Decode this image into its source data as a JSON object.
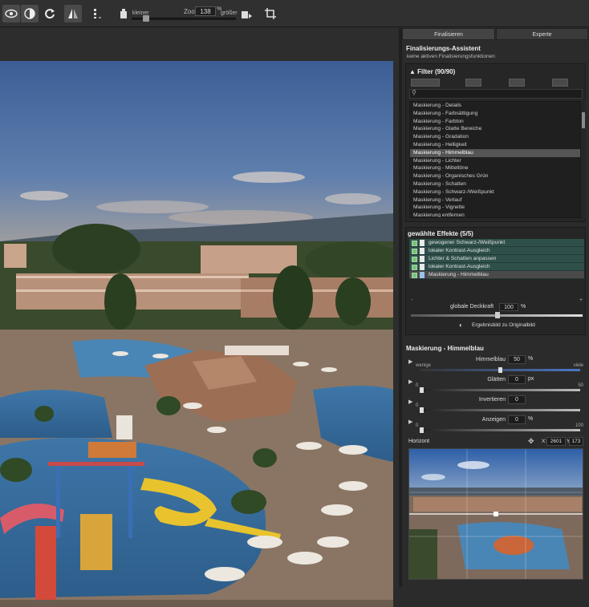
{
  "toolbar": {
    "zoom_small": "kleiner",
    "zoom_label": "Zoo",
    "zoom_value": "138",
    "zoom_unit": "%",
    "zoom_large": "größer"
  },
  "tabs": [
    {
      "label": "Finalisieren",
      "active": true
    },
    {
      "label": "Experte",
      "active": false
    }
  ],
  "assistant": {
    "title": "Finalisierungs-Assistent",
    "subtitle": "keine aktiven Finalisierungsfunktionen"
  },
  "filter": {
    "header": "Filter (90/90)",
    "items": [
      "Maskierung - Details",
      "Maskierung - Farbsättigung",
      "Maskierung - Farbton",
      "Maskierung - Glatte Bereiche",
      "Maskierung - Gradation",
      "Maskierung - Helligkeit",
      "Maskierung - Himmelblau",
      "Maskierung - Lichter",
      "Maskierung - Mitteltöne",
      "Maskierung - Organisches Grün",
      "Maskierung - Schatten",
      "Maskierung - Schwarz-/Weißpunkt",
      "Maskierung - Verlauf",
      "Maskierung - Vignette",
      "Maskierung entfernen"
    ],
    "selected_index": 6
  },
  "effects": {
    "header": "gewählte Effekte (5/5)",
    "items": [
      "gewogener Schwarz-/Weißpunkt",
      "lokaler Kontrast-Ausgleich",
      "Lichter & Schatten anpassen",
      "lokaler Kontrast-Ausgleich",
      "Maskierung - Himmelblau"
    ],
    "opacity_label": "globale Deckkraft",
    "opacity_value": "100",
    "opacity_unit": "%",
    "minus": "-",
    "plus": "+",
    "compare_label": "Ergebnisbild zu Originalbild"
  },
  "mask": {
    "title": "Maskierung - Himmelblau",
    "params": [
      {
        "label": "Himmelblau",
        "value": "50",
        "unit": "%",
        "min": "wenige",
        "max": "viele",
        "level": 0.5
      },
      {
        "label": "Glätten",
        "value": "0",
        "unit": "px",
        "min": "0",
        "max": "50",
        "level": 0.0
      },
      {
        "label": "Invertieren",
        "value": "0",
        "unit": "",
        "min": "0",
        "max": "",
        "level": 0.0
      },
      {
        "label": "Anzeigen",
        "value": "0",
        "unit": "%",
        "min": "0",
        "max": "100",
        "level": 0.0
      }
    ]
  },
  "horizont": {
    "label": "Horizont",
    "x_label": "X:",
    "x_value": "2601",
    "y_label": "Y:",
    "y_value": "173"
  },
  "colors": {
    "accent_blue": "#4a78c8",
    "effect_green": "#2f4f4a",
    "panel_bg": "#2b2b2b"
  }
}
